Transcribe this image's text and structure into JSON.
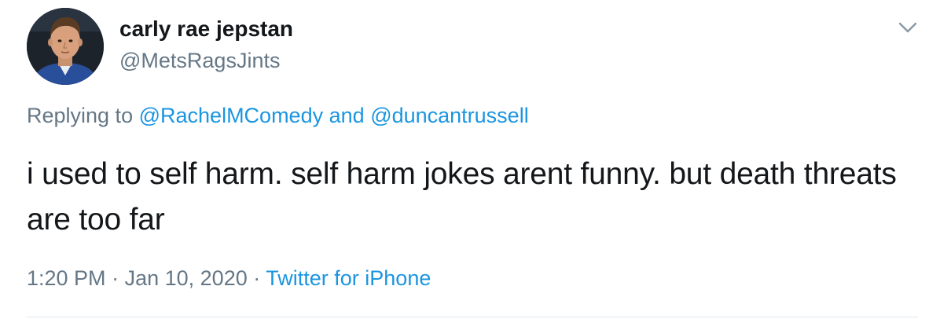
{
  "author": {
    "display_name": "carly rae jepstan",
    "handle": "@MetsRagsJints",
    "avatar": "profile-photo"
  },
  "menu": {
    "icon": "chevron-down-icon"
  },
  "reply_context": {
    "prefix": "Replying to",
    "mention_1": "@RachelMComedy",
    "conjunction": "and",
    "mention_2": "@duncantrussell"
  },
  "tweet": {
    "text": "i used to self harm. self harm jokes arent funny. but death threats are too far"
  },
  "meta": {
    "time": "1:20 PM",
    "separator": "·",
    "date": "Jan 10, 2020",
    "source": "Twitter for iPhone"
  },
  "colors": {
    "link": "#1b95e0",
    "secondary_text": "#657786",
    "primary_text": "#14171a",
    "divider": "#e1e8ed"
  }
}
